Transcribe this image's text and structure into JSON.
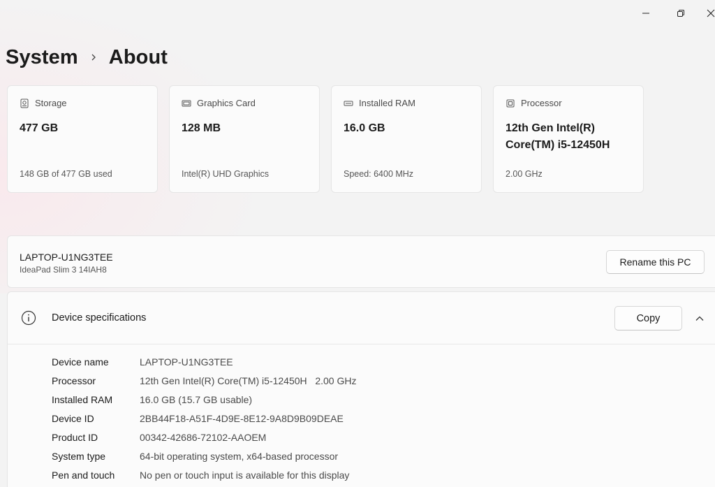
{
  "window": {
    "minimize_icon": "minimize-icon",
    "restore_icon": "restore-icon",
    "close_icon": "close-icon"
  },
  "breadcrumb": {
    "parent": "System",
    "current": "About"
  },
  "cards": [
    {
      "icon": "storage-icon",
      "title": "Storage",
      "value": "477 GB",
      "sub": "148 GB of 477 GB used"
    },
    {
      "icon": "graphics-card-icon",
      "title": "Graphics Card",
      "value": "128 MB",
      "sub": "Intel(R) UHD Graphics"
    },
    {
      "icon": "ram-icon",
      "title": "Installed RAM",
      "value": "16.0 GB",
      "sub": "Speed: 6400 MHz"
    },
    {
      "icon": "processor-icon",
      "title": "Processor",
      "value": "12th Gen Intel(R) Core(TM) i5-12450H",
      "sub": "2.00 GHz"
    }
  ],
  "pc": {
    "name": "LAPTOP-U1NG3TEE",
    "model": "IdeaPad Slim 3 14IAH8",
    "rename_label": "Rename this PC"
  },
  "specs": {
    "title": "Device specifications",
    "copy_label": "Copy",
    "rows": [
      {
        "label": "Device name",
        "value": "LAPTOP-U1NG3TEE"
      },
      {
        "label": "Processor",
        "value": "12th Gen Intel(R) Core(TM) i5-12450H   2.00 GHz"
      },
      {
        "label": "Installed RAM",
        "value": "16.0 GB (15.7 GB usable)"
      },
      {
        "label": "Device ID",
        "value": "2BB44F18-A51F-4D9E-8E12-9A8D9B09DEAE"
      },
      {
        "label": "Product ID",
        "value": "00342-42686-72102-AAOEM"
      },
      {
        "label": "System type",
        "value": "64-bit operating system, x64-based processor"
      },
      {
        "label": "Pen and touch",
        "value": "No pen or touch input is available for this display"
      }
    ]
  }
}
